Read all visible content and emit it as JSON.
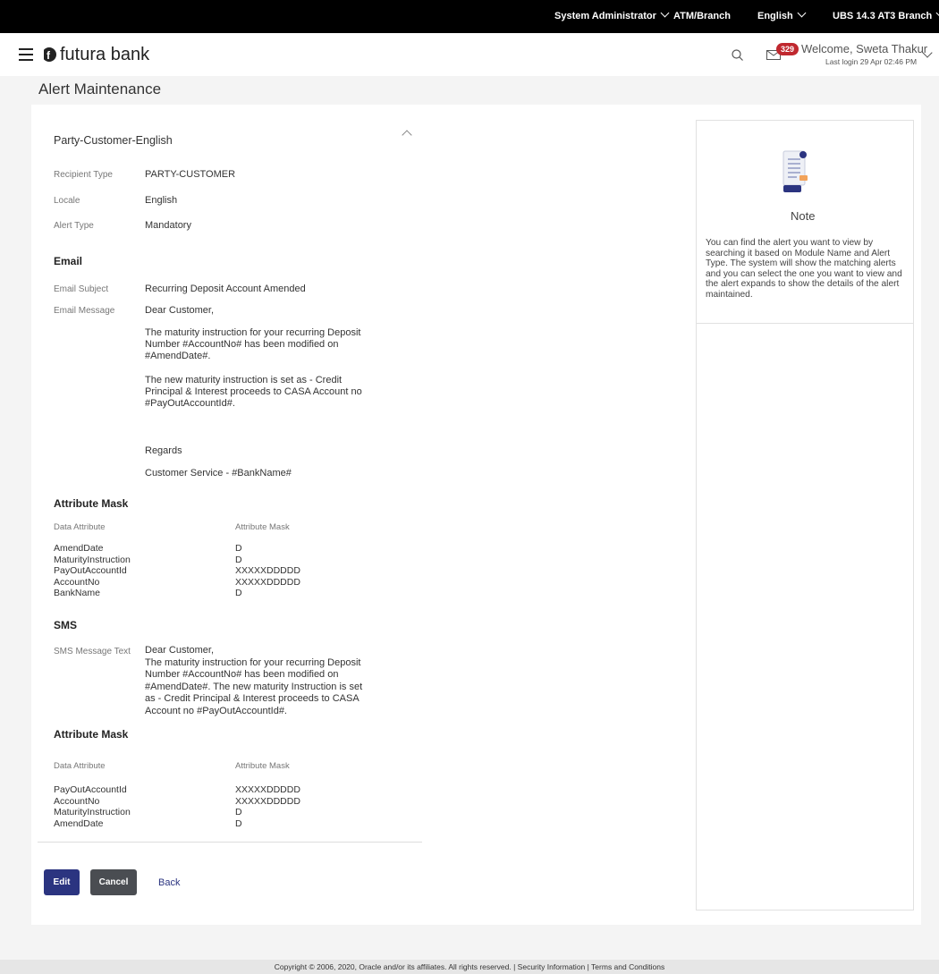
{
  "topbar": {
    "role": "System Administrator",
    "atm_branch": "ATM/Branch",
    "language": "English",
    "branch": "UBS 14.3 AT3 Branch"
  },
  "header": {
    "brand": "futura bank",
    "mail_count": "329",
    "welcome": "Welcome, Sweta Thakur",
    "last_login": "Last login 29 Apr 02:46 PM"
  },
  "page": {
    "title": "Alert Maintenance"
  },
  "alert": {
    "section_title": "Party-Customer-English",
    "fields": [
      {
        "label": "Recipient Type",
        "value": "PARTY-CUSTOMER"
      },
      {
        "label": "Locale",
        "value": "English"
      },
      {
        "label": "Alert Type",
        "value": "Mandatory"
      }
    ],
    "email": {
      "heading": "Email",
      "subject_label": "Email Subject",
      "subject": "Recurring Deposit Account Amended",
      "message_label": "Email Message",
      "message": [
        "Dear Customer,",
        "The maturity instruction for your recurring Deposit Number #AccountNo# has been modified on #AmendDate#.",
        "The new maturity instruction is set as - Credit Principal & Interest proceeds to CASA Account no #PayOutAccountId#.",
        "Regards",
        "Customer Service - #BankName#"
      ]
    },
    "email_mask": {
      "heading": "Attribute Mask",
      "col_attribute": "Data Attribute",
      "col_mask": "Attribute Mask",
      "rows": [
        {
          "attribute": "AmendDate",
          "mask": "D"
        },
        {
          "attribute": "MaturityInstruction",
          "mask": "D"
        },
        {
          "attribute": "PayOutAccountId",
          "mask": "XXXXXDDDDD"
        },
        {
          "attribute": "AccountNo",
          "mask": "XXXXXDDDDD"
        },
        {
          "attribute": "BankName",
          "mask": "D"
        }
      ]
    },
    "sms": {
      "heading": "SMS",
      "label": "SMS Message Text",
      "text_lines": [
        "Dear Customer,",
        "The maturity instruction for your recurring Deposit",
        "Number #AccountNo# has been modified on",
        "#AmendDate#. The new maturity Instruction is set",
        "as - Credit Principal & Interest proceeds to CASA",
        "Account no #PayOutAccountId#."
      ]
    },
    "sms_mask": {
      "heading": "Attribute Mask",
      "col_attribute": "Data Attribute",
      "col_mask": "Attribute Mask",
      "rows": [
        {
          "attribute": "PayOutAccountId",
          "mask": "XXXXXDDDDD"
        },
        {
          "attribute": "AccountNo",
          "mask": "XXXXXDDDDD"
        },
        {
          "attribute": "MaturityInstruction",
          "mask": "D"
        },
        {
          "attribute": "AmendDate",
          "mask": "D"
        }
      ]
    }
  },
  "actions": {
    "edit": "Edit",
    "cancel": "Cancel",
    "back": "Back"
  },
  "note": {
    "title": "Note",
    "text": "You can find the alert you want to view by searching it based on Module Name and Alert Type. The system will show the matching alerts and you can select the one you want to view and the alert expands to show the details of the alert maintained."
  },
  "footer": {
    "text": "Copyright © 2006, 2020, Oracle and/or its affiliates. All rights reserved. | Security Information | Terms and Conditions"
  },
  "colors": {
    "primary": "#2b3480",
    "secondary": "#4a4d52",
    "badge": "#c0282f"
  }
}
